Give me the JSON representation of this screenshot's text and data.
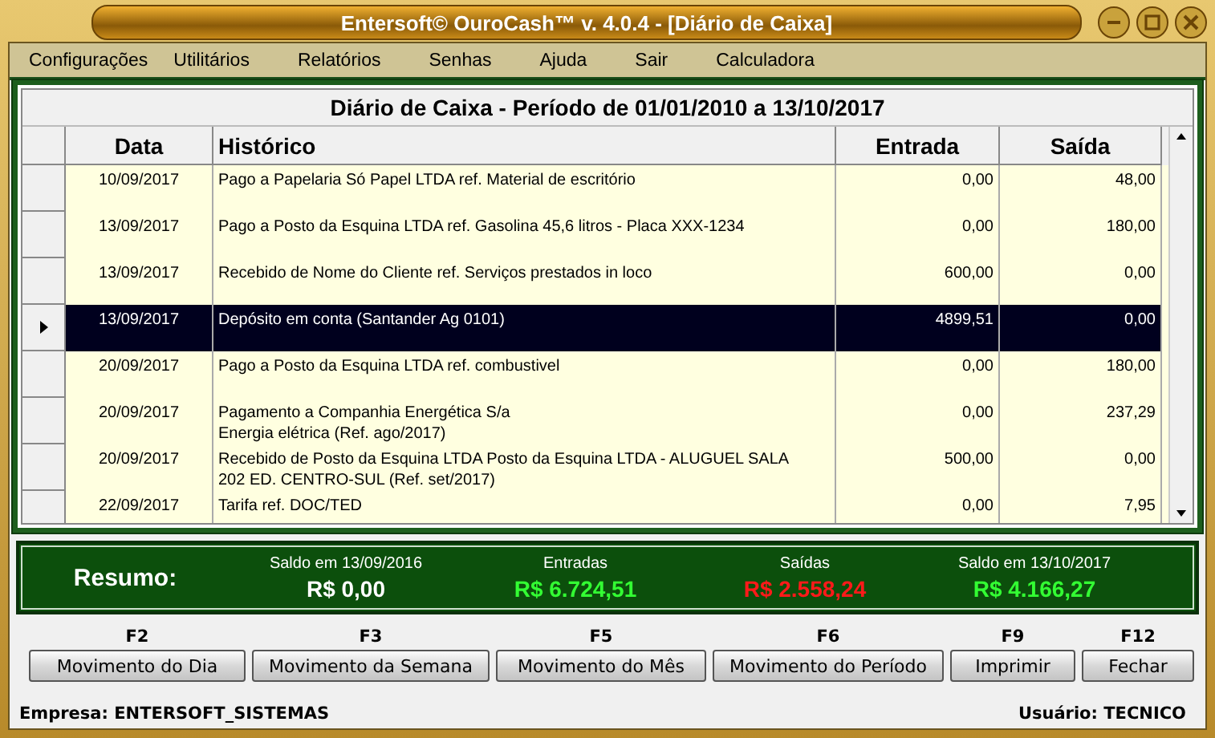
{
  "window": {
    "title": "Entersoft© OuroCash™ v. 4.0.4 - [Diário de Caixa]"
  },
  "menu": [
    "Configurações",
    "Utilitários",
    "Relatórios",
    "Senhas",
    "Ajuda",
    "Sair",
    "Calculadora"
  ],
  "grid": {
    "title": "Diário de Caixa - Período de 01/01/2010 a 13/10/2017",
    "columns": [
      "Data",
      "Histórico",
      "Entrada",
      "Saída"
    ],
    "rows": [
      {
        "date": "10/09/2017",
        "history": "Pago a Papelaria Só Papel LTDA ref. Material de escritório",
        "in": "0,00",
        "out": "48,00",
        "selected": false
      },
      {
        "date": "13/09/2017",
        "history": "Pago a Posto da Esquina LTDA ref. Gasolina 45,6 litros - Placa XXX-1234",
        "in": "0,00",
        "out": "180,00",
        "selected": false
      },
      {
        "date": "13/09/2017",
        "history": "Recebido de Nome do Cliente ref. Serviços prestados in loco",
        "in": "600,00",
        "out": "0,00",
        "selected": false
      },
      {
        "date": "13/09/2017",
        "history": "Depósito em conta (Santander Ag 0101)",
        "in": "4899,51",
        "out": "0,00",
        "selected": true
      },
      {
        "date": "20/09/2017",
        "history": "Pago a Posto da Esquina LTDA ref. combustivel",
        "in": "0,00",
        "out": "180,00",
        "selected": false
      },
      {
        "date": "20/09/2017",
        "history": "Pagamento a Companhia Energética S/a\nEnergia elétrica (Ref. ago/2017)",
        "in": "0,00",
        "out": "237,29",
        "selected": false
      },
      {
        "date": "20/09/2017",
        "history": "Recebido de Posto da Esquina LTDA Posto da Esquina LTDA - ALUGUEL SALA\n202 ED. CENTRO-SUL (Ref. set/2017)",
        "in": "500,00",
        "out": "0,00",
        "selected": false
      },
      {
        "date": "22/09/2017",
        "history": "Tarifa ref. DOC/TED",
        "in": "0,00",
        "out": "7,95",
        "selected": false
      }
    ]
  },
  "summary": {
    "label": "Resumo:",
    "items": [
      {
        "caption": "Saldo em 13/09/2016",
        "value": "R$ 0,00",
        "color": "#ffffff"
      },
      {
        "caption": "Entradas",
        "value": "R$ 6.724,51",
        "color": "#33ff33"
      },
      {
        "caption": "Saídas",
        "value": "R$ 2.558,24",
        "color": "#ff1a1a"
      },
      {
        "caption": "Saldo em 13/10/2017",
        "value": "R$ 4.166,27",
        "color": "#33ff33"
      }
    ]
  },
  "buttons": [
    {
      "key": "F2",
      "label": "Movimento do Dia"
    },
    {
      "key": "F3",
      "label": "Movimento da Semana"
    },
    {
      "key": "F5",
      "label": "Movimento do Mês"
    },
    {
      "key": "F6",
      "label": "Movimento do Período"
    },
    {
      "key": "F9",
      "label": "Imprimir"
    },
    {
      "key": "F12",
      "label": "Fechar"
    }
  ],
  "status_bar": {
    "left": "Empresa: ENTERSOFT_SISTEMAS",
    "right": "Usuário: TECNICO"
  }
}
